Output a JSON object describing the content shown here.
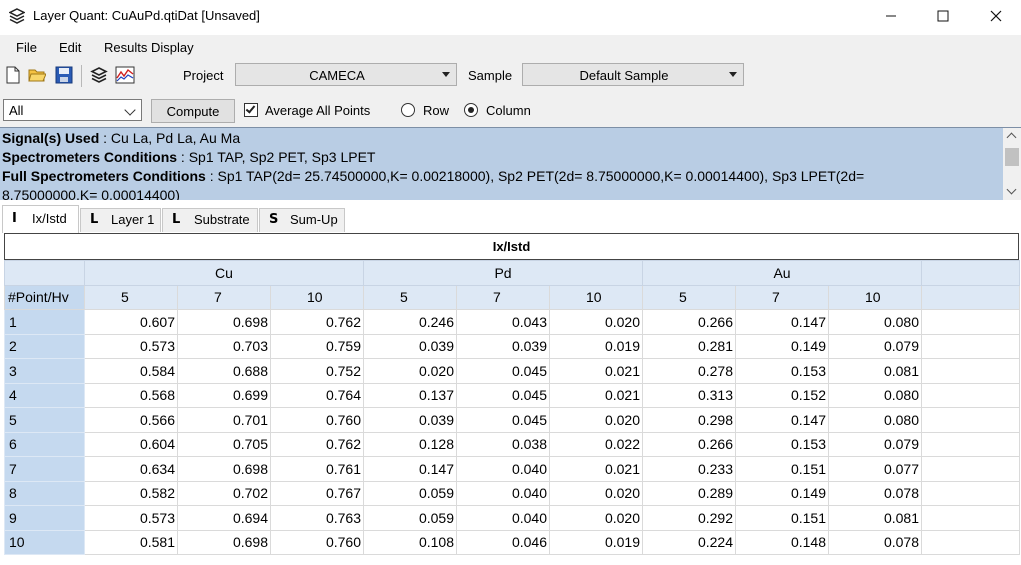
{
  "window": {
    "title": "Layer Quant: CuAuPd.qtiDat [Unsaved]",
    "icon": "stack-layers-icon"
  },
  "menu": [
    "File",
    "Edit",
    "Results Display"
  ],
  "toolbar": {
    "icons": [
      "new-file-icon",
      "open-folder-icon",
      "save-icon",
      "layers-icon",
      "chart-icon"
    ],
    "project_label": "Project",
    "project_value": "CAMECA",
    "sample_label": "Sample",
    "sample_value": "Default Sample",
    "filter_value": "All",
    "compute_label": "Compute",
    "average_label": "Average All Points",
    "average_checked": true,
    "row_label": "Row",
    "column_label": "Column",
    "selected_mode": "Column"
  },
  "info": {
    "signals_label": "Signal(s) Used",
    "signals_value": ": Cu La, Pd La, Au Ma",
    "spectro_label": "Spectrometers Conditions",
    "spectro_value": ":  Sp1 TAP,   Sp2 PET,   Sp3 LPET",
    "full_label": "Full Spectrometers Conditions",
    "full_value": ":  Sp1 TAP(2d= 25.74500000,K= 0.00218000),   Sp2 PET(2d= 8.75000000,K= 0.00014400),   Sp3 LPET(2d=",
    "full_value_cont": "8.75000000,K= 0.00014400)"
  },
  "tabs": [
    {
      "label": "Ix/Istd",
      "glyph": "I",
      "active": true
    },
    {
      "label": "Layer 1",
      "glyph": "L",
      "active": false
    },
    {
      "label": "Substrate",
      "glyph": "L",
      "active": false
    },
    {
      "label": "Sum-Up",
      "glyph": "S",
      "active": false
    }
  ],
  "table": {
    "title": "Ix/Istd",
    "corner_label": "#Point/Hv",
    "elements": [
      "Cu",
      "Pd",
      "Au"
    ],
    "hv": [
      "5",
      "7",
      "10"
    ],
    "rows": [
      {
        "point": "1",
        "values": [
          "0.607",
          "0.698",
          "0.762",
          "0.246",
          "0.043",
          "0.020",
          "0.266",
          "0.147",
          "0.080"
        ]
      },
      {
        "point": "2",
        "values": [
          "0.573",
          "0.703",
          "0.759",
          "0.039",
          "0.039",
          "0.019",
          "0.281",
          "0.149",
          "0.079"
        ]
      },
      {
        "point": "3",
        "values": [
          "0.584",
          "0.688",
          "0.752",
          "0.020",
          "0.045",
          "0.021",
          "0.278",
          "0.153",
          "0.081"
        ]
      },
      {
        "point": "4",
        "values": [
          "0.568",
          "0.699",
          "0.764",
          "0.137",
          "0.045",
          "0.021",
          "0.313",
          "0.152",
          "0.080"
        ]
      },
      {
        "point": "5",
        "values": [
          "0.566",
          "0.701",
          "0.760",
          "0.039",
          "0.045",
          "0.020",
          "0.298",
          "0.147",
          "0.080"
        ]
      },
      {
        "point": "6",
        "values": [
          "0.604",
          "0.705",
          "0.762",
          "0.128",
          "0.038",
          "0.022",
          "0.266",
          "0.153",
          "0.079"
        ]
      },
      {
        "point": "7",
        "values": [
          "0.634",
          "0.698",
          "0.761",
          "0.147",
          "0.040",
          "0.021",
          "0.233",
          "0.151",
          "0.077"
        ]
      },
      {
        "point": "8",
        "values": [
          "0.582",
          "0.702",
          "0.767",
          "0.059",
          "0.040",
          "0.020",
          "0.289",
          "0.149",
          "0.078"
        ]
      },
      {
        "point": "9",
        "values": [
          "0.573",
          "0.694",
          "0.763",
          "0.059",
          "0.040",
          "0.020",
          "0.292",
          "0.151",
          "0.081"
        ]
      },
      {
        "point": "10",
        "values": [
          "0.581",
          "0.698",
          "0.760",
          "0.108",
          "0.046",
          "0.019",
          "0.224",
          "0.148",
          "0.078"
        ]
      }
    ]
  }
}
